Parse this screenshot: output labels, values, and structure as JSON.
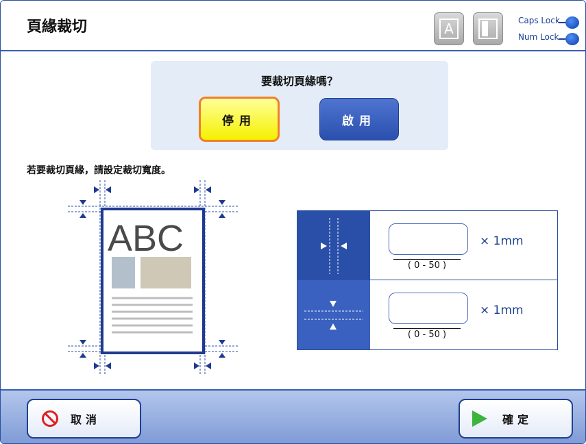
{
  "header": {
    "title": "頁緣裁切",
    "kbd_a_label": "A",
    "caps_lock": "Caps Lock",
    "num_lock": "Num Lock"
  },
  "question": {
    "text": "要裁切頁緣嗎？",
    "disable_label": "停用",
    "enable_label": "啟用",
    "selected": "停用"
  },
  "instruction": "若要裁切頁緣，請設定裁切寬度。",
  "diagram": {
    "sample_text": "ABC"
  },
  "settings": [
    {
      "name": "horizontal-margin",
      "value": "",
      "unit": "× 1mm",
      "range": "( 0 - 50 )"
    },
    {
      "name": "vertical-margin",
      "value": "",
      "unit": "× 1mm",
      "range": "( 0 - 50 )"
    }
  ],
  "footer": {
    "cancel_label": "取消",
    "ok_label": "確定"
  },
  "colors": {
    "accent": "#2a4fa8",
    "selected_button": "#f5f000",
    "selected_border": "#f07e2a",
    "cancel_icon": "#e01e1e",
    "ok_icon": "#3db43d"
  },
  "icons": [
    "cancel-icon",
    "ok-arrow-icon",
    "horizontal-margin-icon",
    "vertical-margin-icon",
    "keyboard-a-icon",
    "keyboard-layout-icon"
  ]
}
